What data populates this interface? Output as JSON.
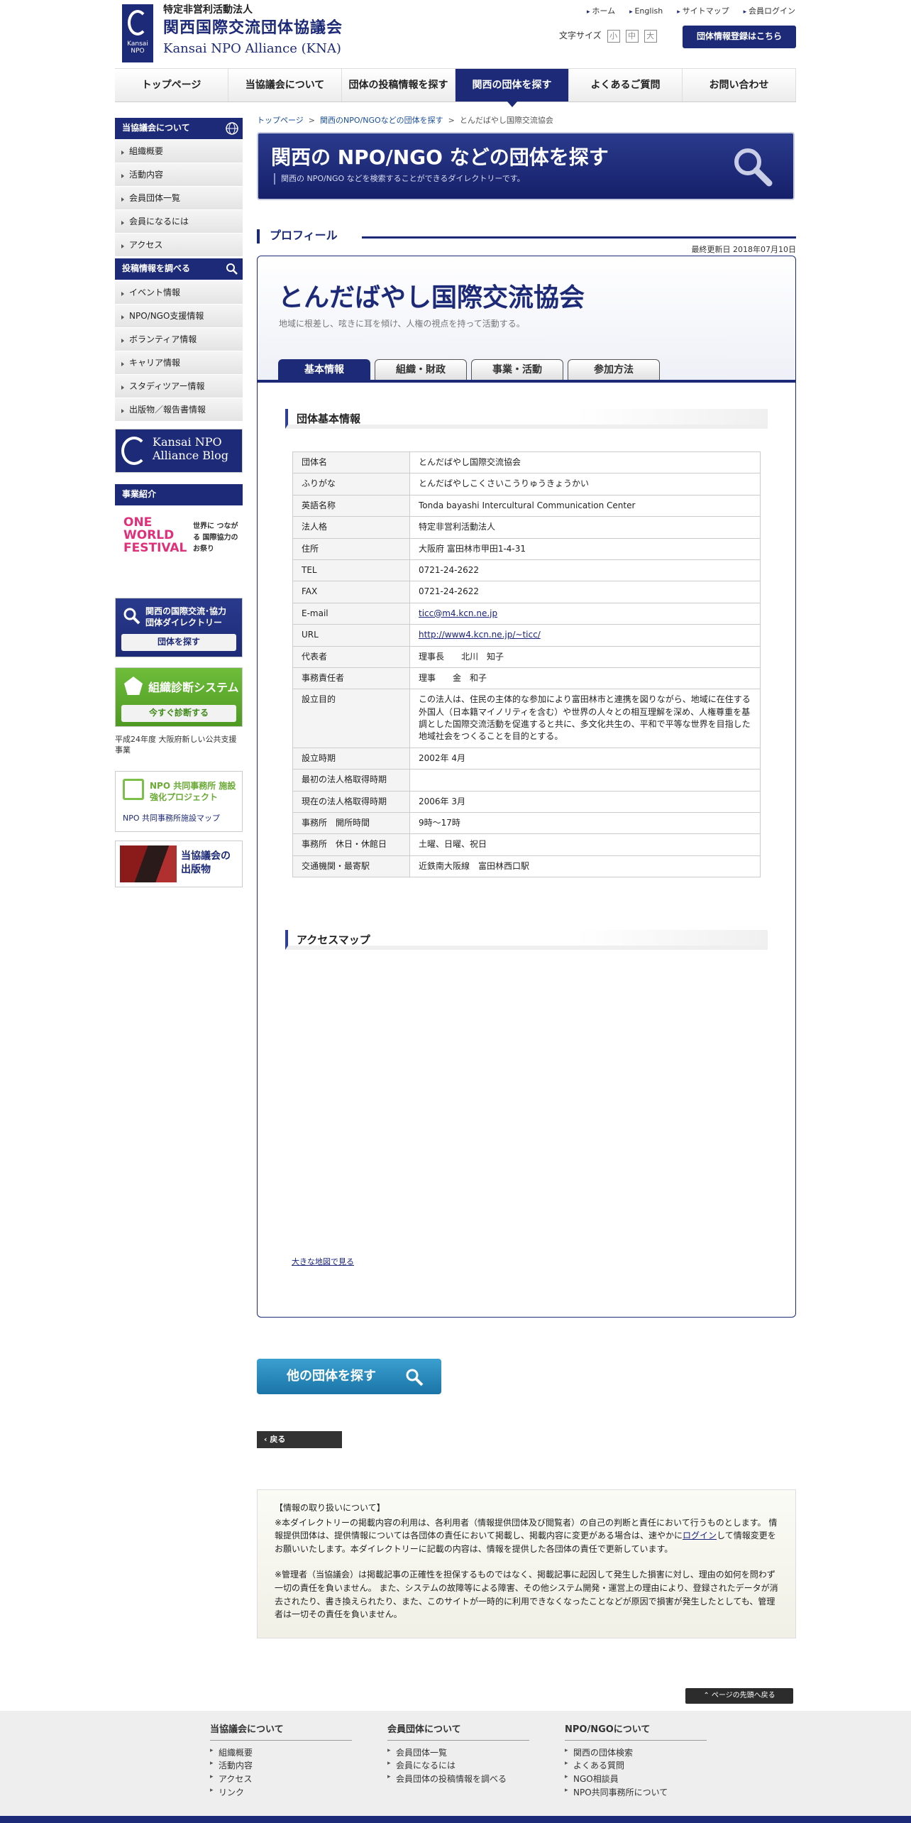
{
  "header": {
    "logo_mark": "Kansai NPO",
    "logo_sub": "特定非営利活動法人",
    "logo_jp": "関西国際交流団体協議会",
    "logo_en": "Kansai NPO Alliance (KNA)",
    "top_links": [
      "ホーム",
      "English",
      "サイトマップ",
      "会員ログイン"
    ],
    "font_size_label": "文字サイズ",
    "font_sizes": [
      "小",
      "中",
      "大"
    ],
    "register_button": "団体情報登録はこちら"
  },
  "gnav": [
    "トップページ",
    "当協議会について",
    "団体の投稿情報を探す",
    "関西の団体を探す",
    "よくあるご質問",
    "お問い合わせ"
  ],
  "sidebar": {
    "about_heading": "当協議会について",
    "about_items": [
      "組織概要",
      "活動内容",
      "会員団体一覧",
      "会員になるには",
      "アクセス"
    ],
    "search_heading": "投稿情報を調べる",
    "search_items": [
      "イベント情報",
      "NPO/NGO支援情報",
      "ボランティア情報",
      "キャリア情報",
      "スタディツアー情報",
      "出版物／報告書情報"
    ],
    "blog_banner": "Kansai NPO Alliance Blog",
    "project_heading": "事業紹介",
    "owf_logo": "ONE WORLD FESTIVAL",
    "owf_text": "世界に つながる 国際協力の お祭り",
    "directory_title": "関西の国際交流･協力 団体ダイレクトリー",
    "directory_btn": "団体を探す",
    "diag_title": "組織診断システム",
    "diag_btn": "今すぐ診断する",
    "diag_note": "平成24年度 大阪府新しい公共支援事業",
    "office_title": "NPO 共同事務所 施設強化プロジェクト",
    "office_link": "NPO 共同事務所施設マップ",
    "pub_title": "当協議会の 出版物"
  },
  "breadcrumb": [
    "トップページ",
    "関西のNPO/NGOなどの団体を探す",
    "とんだばやし国際交流協会"
  ],
  "hero": {
    "title": "関西の NPO/NGO などの団体を探す",
    "subtitle": "関西の NPO/NGO などを検索することができるダイレクトリーです。"
  },
  "profile": {
    "heading": "プロフィール",
    "updated": "最終更新日 2018年07月10日",
    "org_name": "とんだばやし国際交流協会",
    "catch": "地域に根差し、呟きに耳を傾け、人権の視点を持って活動する。",
    "tabs": [
      "基本情報",
      "組織・財政",
      "事業・活動",
      "参加方法"
    ],
    "basic_heading": "団体基本情報",
    "rows": [
      {
        "label": "団体名",
        "value": "とんだばやし国際交流協会"
      },
      {
        "label": "ふりがな",
        "value": "とんだばやしこくさいこうりゅうきょうかい"
      },
      {
        "label": "英語名称",
        "value": "Tonda bayashi Intercultural Communication Center"
      },
      {
        "label": "法人格",
        "value": "特定非営利活動法人"
      },
      {
        "label": "住所",
        "value": "大阪府 富田林市甲田1-4-31"
      },
      {
        "label": "TEL",
        "value": "0721-24-2622"
      },
      {
        "label": "FAX",
        "value": "0721-24-2622"
      },
      {
        "label": "E-mail",
        "value": "ticc@m4.kcn.ne.jp",
        "link": true
      },
      {
        "label": "URL",
        "value": "http://www4.kcn.ne.jp/~ticc/",
        "link": true
      },
      {
        "label": "代表者",
        "value": "理事長　　北川　知子"
      },
      {
        "label": "事務責任者",
        "value": "理事　　金　和子"
      },
      {
        "label": "設立目的",
        "value": "この法人は、住民の主体的な参加により富田林市と連携を図りながら、地域に在住する外国人（日本籍マイノリティを含む）や世界の人々との相互理解を深め、人権尊重を基調とした国際交流活動を促進すると共に、多文化共生の、平和で平等な世界を目指した地域社会をつくることを目的とする。"
      },
      {
        "label": "設立時期",
        "value": "2002年 4月"
      },
      {
        "label": "最初の法人格取得時期",
        "value": ""
      },
      {
        "label": "現在の法人格取得時期",
        "value": "2006年 3月"
      },
      {
        "label": "事務所　開所時間",
        "value": "9時～17時"
      },
      {
        "label": "事務所　休日・休館日",
        "value": "土曜、日曜、祝日"
      },
      {
        "label": "交通機関・最寄駅",
        "value": "近鉄南大阪線　富田林西口駅"
      }
    ],
    "access_heading": "アクセスマップ",
    "big_map_link": "大きな地図で見る"
  },
  "find_other_button": "他の団体を探す",
  "back_button": "戻る",
  "notice": {
    "title": "【情報の取り扱いについて】",
    "p1_a": "※本ダイレクトリーの掲載内容の利用は、各利用者（情報提供団体及び閲覧者）の自己の判断と責任において行うものとします。 情報提供団体は、提供情報については各団体の責任において掲載し、掲載内容に変更がある場合は、速やかに",
    "p1_link": "ログイン",
    "p1_b": "して情報変更をお願いいたします。本ダイレクトリーに記載の内容は、情報を提供した各団体の責任で更新しています。",
    "p2": "※管理者（当協議会）は掲載記事の正確性を担保するものではなく、掲載記事に起因して発生した損害に対し、理由の如何を問わず一切の責任を負いません。 また、システムの故障等による障害、その他システム開発・運営上の理由により、登録されたデータが消去されたり、書き換えられたり、また、このサイトが一時的に利用できなくなったことなどが原因で損害が発生したとしても、管理者は一切その責任を負いません。"
  },
  "page_top": "ページの先頭へ戻る",
  "footer": [
    {
      "heading": "当協議会について",
      "items": [
        "組織概要",
        "活動内容",
        "アクセス",
        "リンク"
      ]
    },
    {
      "heading": "会員団体について",
      "items": [
        "会員団体一覧",
        "会員になるには",
        "会員団体の投稿情報を調べる"
      ]
    },
    {
      "heading": "NPO/NGOについて",
      "items": [
        "関西の団体検索",
        "よくある質問",
        "NGO相談員",
        "NPO共同事務所について"
      ]
    }
  ]
}
